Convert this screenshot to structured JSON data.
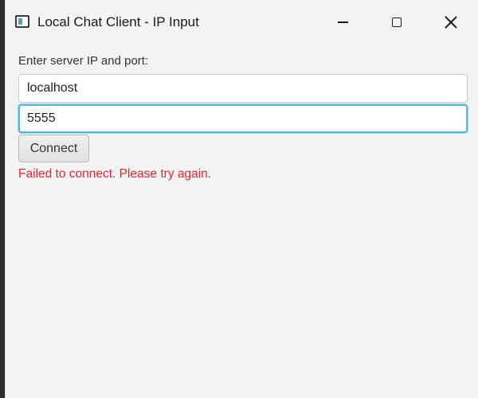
{
  "window": {
    "title": "Local Chat Client - IP Input",
    "icon": "app-window-icon",
    "controls": [
      "minimize-icon",
      "maximize-icon",
      "close-icon"
    ]
  },
  "form": {
    "prompt_label": "Enter server IP and port:",
    "host_value": "localhost",
    "port_value": "5555",
    "connect_label": "Connect",
    "error_message": "Failed to connect. Please try again."
  },
  "colors": {
    "error": "#e8262d",
    "focus_border": "#5cb6df",
    "background": "#f3f3f3"
  }
}
